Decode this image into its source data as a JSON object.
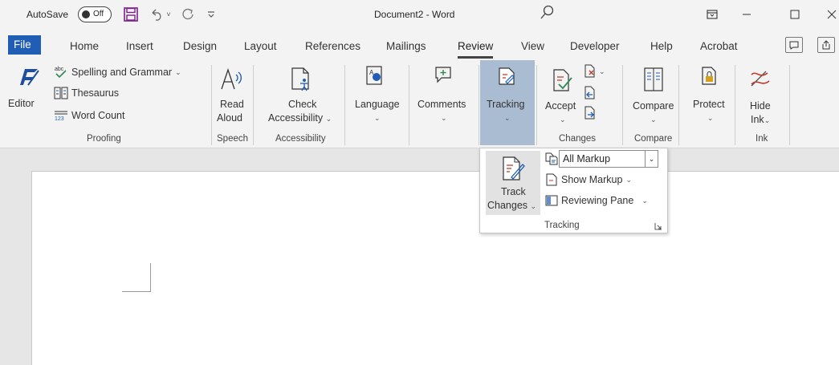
{
  "titlebar": {
    "autosave_label": "AutoSave",
    "autosave_state": "Off",
    "document_title": "Document2 - Word"
  },
  "tabs": [
    {
      "label": "File"
    },
    {
      "label": "Home"
    },
    {
      "label": "Insert"
    },
    {
      "label": "Design"
    },
    {
      "label": "Layout"
    },
    {
      "label": "References"
    },
    {
      "label": "Mailings"
    },
    {
      "label": "Review"
    },
    {
      "label": "View"
    },
    {
      "label": "Developer"
    },
    {
      "label": "Help"
    },
    {
      "label": "Acrobat"
    }
  ],
  "ribbon": {
    "proofing": {
      "editor": "Editor",
      "spelling": "Spelling and Grammar",
      "thesaurus": "Thesaurus",
      "word_count": "Word Count",
      "group": "Proofing"
    },
    "speech": {
      "read": "Read",
      "aloud": "Aloud",
      "group": "Speech"
    },
    "accessibility": {
      "check": "Check",
      "accessibility": "Accessibility",
      "group": "Accessibility"
    },
    "language": {
      "label": "Language"
    },
    "comments": {
      "label": "Comments"
    },
    "tracking": {
      "label": "Tracking"
    },
    "changes": {
      "accept": "Accept",
      "group": "Changes"
    },
    "compare": {
      "label": "Compare",
      "group": "Compare"
    },
    "protect": {
      "label": "Protect"
    },
    "ink": {
      "hide": "Hide",
      "ink": "Ink",
      "group": "Ink"
    }
  },
  "dropdown": {
    "track": "Track",
    "changes": "Changes",
    "markup_value": "All Markup",
    "show_markup": "Show Markup",
    "reviewing_pane": "Reviewing Pane",
    "group": "Tracking"
  },
  "colors": {
    "file_tab": "#1f5eb4",
    "tracking_highlight": "#a9bcd1",
    "editor_icon": "#1f4e9c",
    "check_green": "#2e8b57",
    "ink_red": "#c0392b"
  }
}
